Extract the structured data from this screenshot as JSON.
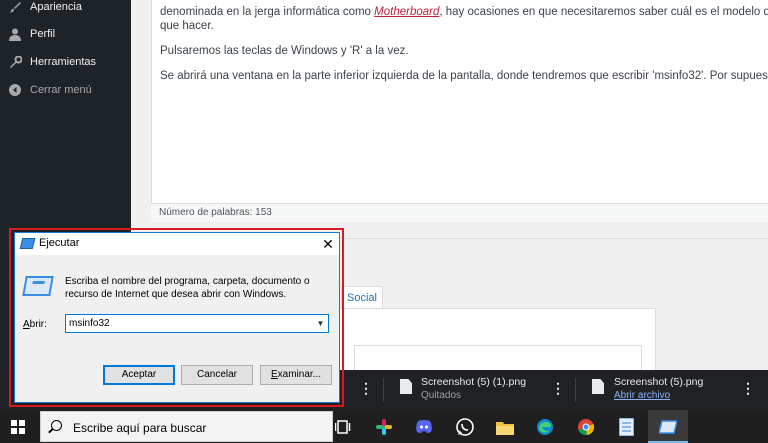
{
  "sidebar": {
    "items": [
      {
        "label": "Apariencia",
        "icon": "paintbrush-icon"
      },
      {
        "label": "Perfil",
        "icon": "user-icon"
      },
      {
        "label": "Herramientas",
        "icon": "wrench-icon"
      },
      {
        "label": "Cerrar menú",
        "icon": "collapse-arrow-icon"
      }
    ]
  },
  "editor": {
    "line1_pre": "denominada en la jerga informática como ",
    "line1_link": "Motherboard",
    "line1_post": ", hay ocasiones en que necesitaremos saber cuál es el modelo d",
    "line2": "que hacer.",
    "para2": "Pulsaremos las teclas de Windows y 'R' a la vez.",
    "para3": "Se abrirá una ventana en la parte inferior izquierda de la pantalla, donde tendremos que escribir 'msinfo32'. Por supues",
    "word_count": "Número de palabras: 153"
  },
  "meta_tabs": {
    "social": "Social"
  },
  "run_dialog": {
    "title": "Ejecutar",
    "close": "✕",
    "description": "Escriba el nombre del programa, carpeta, documento o recurso de Internet que desea abrir con Windows.",
    "open_label_u": "A",
    "open_label_rest": "brir:",
    "input_value": "msinfo32",
    "accept": "Aceptar",
    "cancel": "Cancelar",
    "browse_u": "E",
    "browse_rest": "xaminar..."
  },
  "downloads": [
    {
      "name": "Screenshot (5) (1).png",
      "status": "Quitados"
    },
    {
      "name": "Screenshot (5).png",
      "status": "Abrir archivo"
    }
  ],
  "downloads_menu": "⋮",
  "taskbar": {
    "search_placeholder": "Escribe aquí para buscar"
  },
  "colors": {
    "wp_sidebar": "#1d2327",
    "dialog_outline": "#d71921",
    "accent": "#0078d7",
    "taskbar": "#1f1f1f"
  }
}
